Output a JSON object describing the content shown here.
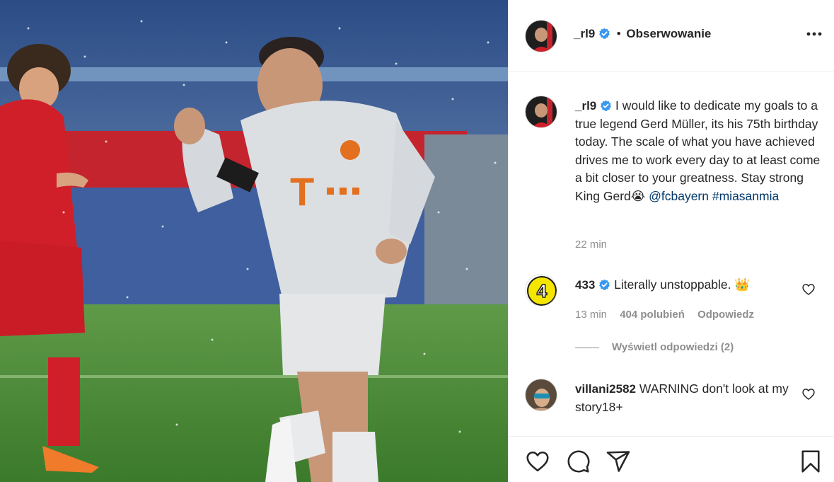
{
  "photo": {
    "subject": "soccer-player-celebrating",
    "colors": {
      "pitch": "#3f7d2f",
      "stands": "#2d4a7d",
      "kit": "#d9dcdf",
      "opponent": "#d3202a"
    }
  },
  "header": {
    "username": "_rl9",
    "separator": "•",
    "follow_label": "Obserwowanie"
  },
  "caption": {
    "username": "_rl9",
    "text": "I would like to dedicate my goals to a true legend Gerd Müller, its his 75th birthday today. The scale of what you have achieved drives me to work every day to at least come a bit closer to your greatness. Stay strong King Gerd😭 ",
    "mention": "@fcbayern",
    "hashtag": "#miasanmia",
    "time": "22 min"
  },
  "comments": [
    {
      "username": "433",
      "text": "Literally unstoppable. 👑",
      "time": "13 min",
      "likes": "404 polubień",
      "reply_label": "Odpowiedz",
      "view_replies": "Wyświetl odpowiedzi (2)",
      "avatar_text": "4"
    },
    {
      "username": "villani2582",
      "text": "WARNING don't look at my story18+"
    }
  ],
  "icons": [
    "more-icon",
    "heart-icon",
    "comment-icon",
    "share-icon",
    "bookmark-icon",
    "verified-icon"
  ],
  "accent": {
    "link": "#00376b",
    "verified": "#3897f0",
    "muted": "#8e8e8e"
  }
}
